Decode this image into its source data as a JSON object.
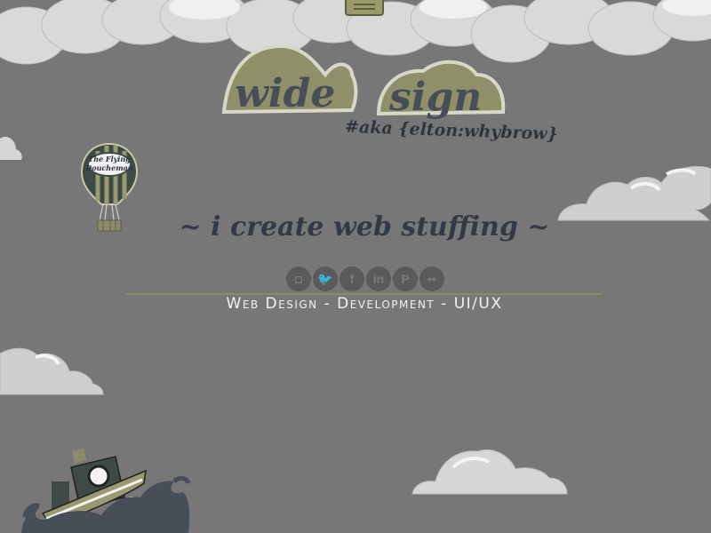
{
  "logo": {
    "word1": "wide",
    "word2": "sign",
    "aka": "#aka {elton:whybrow}"
  },
  "balloon": {
    "label_line1": "The Flying",
    "label_line2": "Doucheman"
  },
  "tagline": "~ i create web stuffing ~",
  "social": [
    {
      "name": "instagram-icon",
      "glyph": "◘"
    },
    {
      "name": "twitter-icon",
      "glyph": "🐦"
    },
    {
      "name": "facebook-icon",
      "glyph": "f"
    },
    {
      "name": "linkedin-icon",
      "glyph": "in"
    },
    {
      "name": "pinterest-icon",
      "glyph": "P"
    },
    {
      "name": "flickr-icon",
      "glyph": "••"
    }
  ],
  "services": "Web Design - Development - UI/UX",
  "colors": {
    "background": "#777777",
    "cloud": "#d8d8d8",
    "olive": "#8b8a6c",
    "dark_slate": "#474e57"
  }
}
